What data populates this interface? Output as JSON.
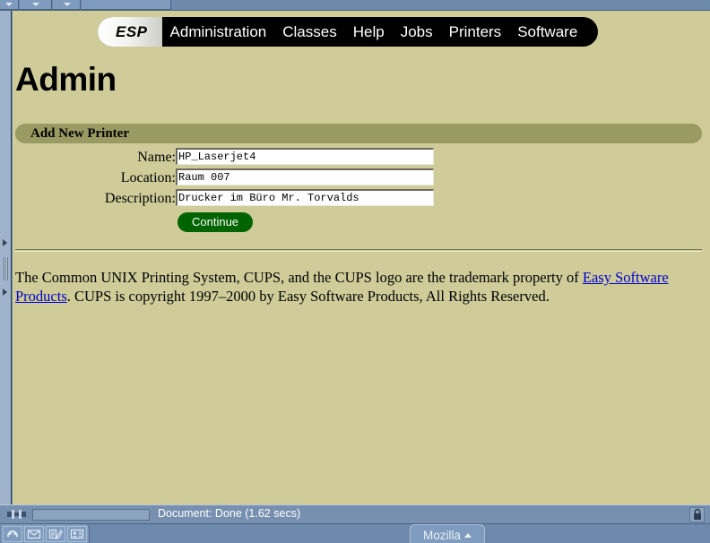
{
  "window": {
    "toolbar_handles": 3
  },
  "nav": {
    "brand": "ESP",
    "items": [
      {
        "label": "Administration"
      },
      {
        "label": "Classes"
      },
      {
        "label": "Help"
      },
      {
        "label": "Jobs"
      },
      {
        "label": "Printers"
      },
      {
        "label": "Software"
      }
    ]
  },
  "page": {
    "title": "Admin",
    "section_title": "Add New Printer"
  },
  "form": {
    "fields": [
      {
        "label": "Name:",
        "value": "HP_Laserjet4"
      },
      {
        "label": "Location:",
        "value": "Raum 007"
      },
      {
        "label": "Description:",
        "value": "Drucker im Büro Mr. Torvalds"
      }
    ],
    "submit_label": "Continue"
  },
  "footer": {
    "part1": "The Common UNIX Printing System, CUPS, and the CUPS logo are the trademark property of ",
    "link": "Easy Software Products",
    "part2": ". CUPS is copyright 1997–2000 by Easy Software Products, All Rights Reserved."
  },
  "status": {
    "text": "Document: Done (1.62 secs)",
    "progress_percent": 0
  },
  "taskbar": {
    "window_button": "Mozilla",
    "tray_icons": [
      "mozilla-lizard-icon",
      "mail-icon",
      "composer-icon",
      "addressbook-icon"
    ]
  },
  "colors": {
    "page_bg": "#cfcc99",
    "section_bar": "#9a9a63",
    "nav_bg": "#000000",
    "button_green": "#006400",
    "link_blue": "#0000cc",
    "chrome_blue": "#6d89ab"
  }
}
